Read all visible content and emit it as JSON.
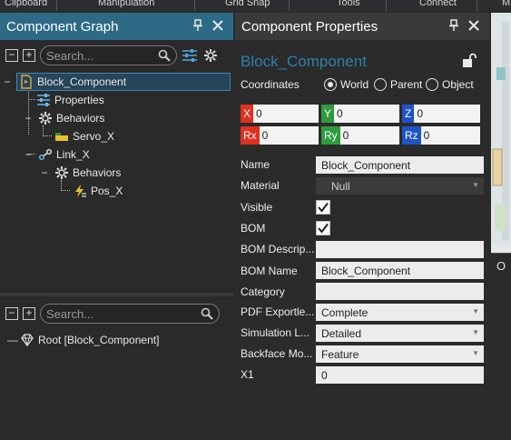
{
  "ribbon": {
    "groups": [
      "Clipboard",
      "Manipulation",
      "Grid Snap",
      "Tools",
      "Connect",
      "M"
    ]
  },
  "component_graph": {
    "title": "Component Graph",
    "search_placeholder": "Search...",
    "tree": [
      {
        "label": "Block_Component",
        "selected": true
      },
      {
        "label": "Properties"
      },
      {
        "label": "Behaviors"
      },
      {
        "label": "Servo_X"
      },
      {
        "label": "Link_X"
      },
      {
        "label": "Behaviors"
      },
      {
        "label": "Pos_X"
      }
    ]
  },
  "root_panel": {
    "search_placeholder": "Search...",
    "root_item": "Root [Block_Component]"
  },
  "component_properties": {
    "title": "Component Properties",
    "component_name": "Block_Component",
    "coordinates_label": "Coordinates",
    "coord_options": [
      "World",
      "Parent",
      "Object"
    ],
    "coord_selected": "World",
    "coords": [
      {
        "tag": "X",
        "value": "0",
        "color": "#e0301e"
      },
      {
        "tag": "Y",
        "value": "0",
        "color": "#2e9c3c"
      },
      {
        "tag": "Z",
        "value": "0",
        "color": "#1f53c9"
      },
      {
        "tag": "Rx",
        "value": "0",
        "color": "#e0301e"
      },
      {
        "tag": "Ry",
        "value": "0",
        "color": "#2e9c3c"
      },
      {
        "tag": "Rz",
        "value": "0",
        "color": "#1f53c9"
      }
    ],
    "props": {
      "name_label": "Name",
      "name_value": "Block_Component",
      "material_label": "Material",
      "material_value": "Null",
      "visible_label": "Visible",
      "bom_label": "BOM",
      "bom_desc_label": "BOM Descrip...",
      "bom_desc_value": "",
      "bom_name_label": "BOM Name",
      "bom_name_value": "Block_Component",
      "category_label": "Category",
      "category_value": "",
      "pdf_label": "PDF Exportle...",
      "pdf_value": "Complete",
      "sim_label": "Simulation L...",
      "sim_value": "Detailed",
      "backface_label": "Backface Mo...",
      "backface_value": "Feature",
      "x1_label": "X1",
      "x1_value": "0"
    }
  },
  "right_strip": {
    "tab_label": "O"
  },
  "colors": {
    "header_active": "#2d6a86",
    "accent_name": "#2d7fa8"
  }
}
